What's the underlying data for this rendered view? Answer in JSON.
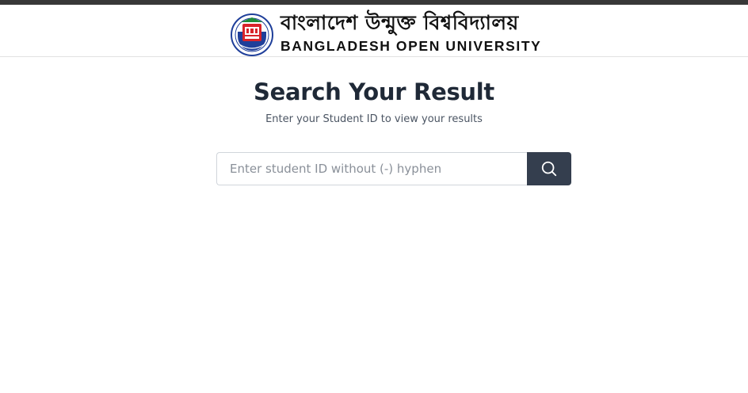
{
  "header": {
    "university_name_bn": "বাংলাদেশ উন্মুক্ত বিশ্ববিদ্যালয়",
    "university_name_en": "BANGLADESH OPEN UNIVERSITY",
    "logo_icon": "university-seal-icon"
  },
  "main": {
    "title": "Search Your Result",
    "subtitle": "Enter your Student ID to view your results"
  },
  "search": {
    "value": "",
    "placeholder": "Enter student ID without (-) hyphen",
    "button_icon": "search-icon"
  },
  "colors": {
    "top_bar": "#383838",
    "heading": "#1f2937",
    "search_button": "#343e4e",
    "logo_blue": "#1f3f9a",
    "logo_red": "#d8232a",
    "logo_green": "#1e8b3a"
  }
}
